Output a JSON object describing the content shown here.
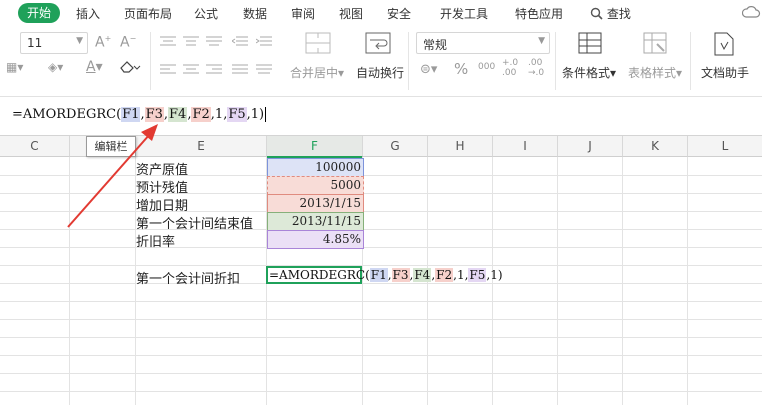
{
  "menu": {
    "items": [
      "开始",
      "插入",
      "页面布局",
      "公式",
      "数据",
      "审阅",
      "视图",
      "安全",
      "开发工具",
      "特色应用",
      "查找"
    ]
  },
  "ribbon": {
    "font_size": "11",
    "number_format": "常规",
    "merge_label": "合并居中",
    "wrap_label": "自动换行",
    "cond_format_label": "条件格式",
    "table_style_label": "表格样式",
    "doc_helper_label": "文档助手",
    "percent": "%",
    "thousands": "000",
    "inc_decimal": "+.0\n.00",
    "dec_decimal": ".00\n→.0"
  },
  "formula_bar": {
    "prefix": "=AMORDEGRC(",
    "refs": [
      "F1",
      "F3",
      "F4",
      "F2"
    ],
    "mid_literal": "1",
    "ref5": "F5",
    "tail": "1)"
  },
  "tooltip": "编辑栏",
  "columns": [
    "C",
    "D",
    "E",
    "F",
    "G",
    "H",
    "I",
    "J",
    "K",
    "L"
  ],
  "rows": [
    {
      "label": "资产原值",
      "value": "100000"
    },
    {
      "label": "预计残值",
      "value": "5000"
    },
    {
      "label": "增加日期",
      "value": "2013/1/15"
    },
    {
      "label": "第一个会计间结束值",
      "value": "2013/11/15"
    },
    {
      "label": "折旧率",
      "value": "4.85%"
    }
  ],
  "result_row": {
    "label": "第一个会计间折扣",
    "formula_prefix": "=AMORDEGRC(",
    "refs": [
      "F1",
      "F3",
      "F4",
      "F2"
    ],
    "mid_literal": "1",
    "ref5": "F5",
    "tail": "1)"
  },
  "colors": {
    "accent_green": "#1fa15a",
    "ref_blue": "#cfd7f2",
    "ref_red": "#f6d0cb",
    "ref_green": "#d5e5d0",
    "ref_purple": "#e4d7f3",
    "arrow_red": "#e23a32"
  }
}
